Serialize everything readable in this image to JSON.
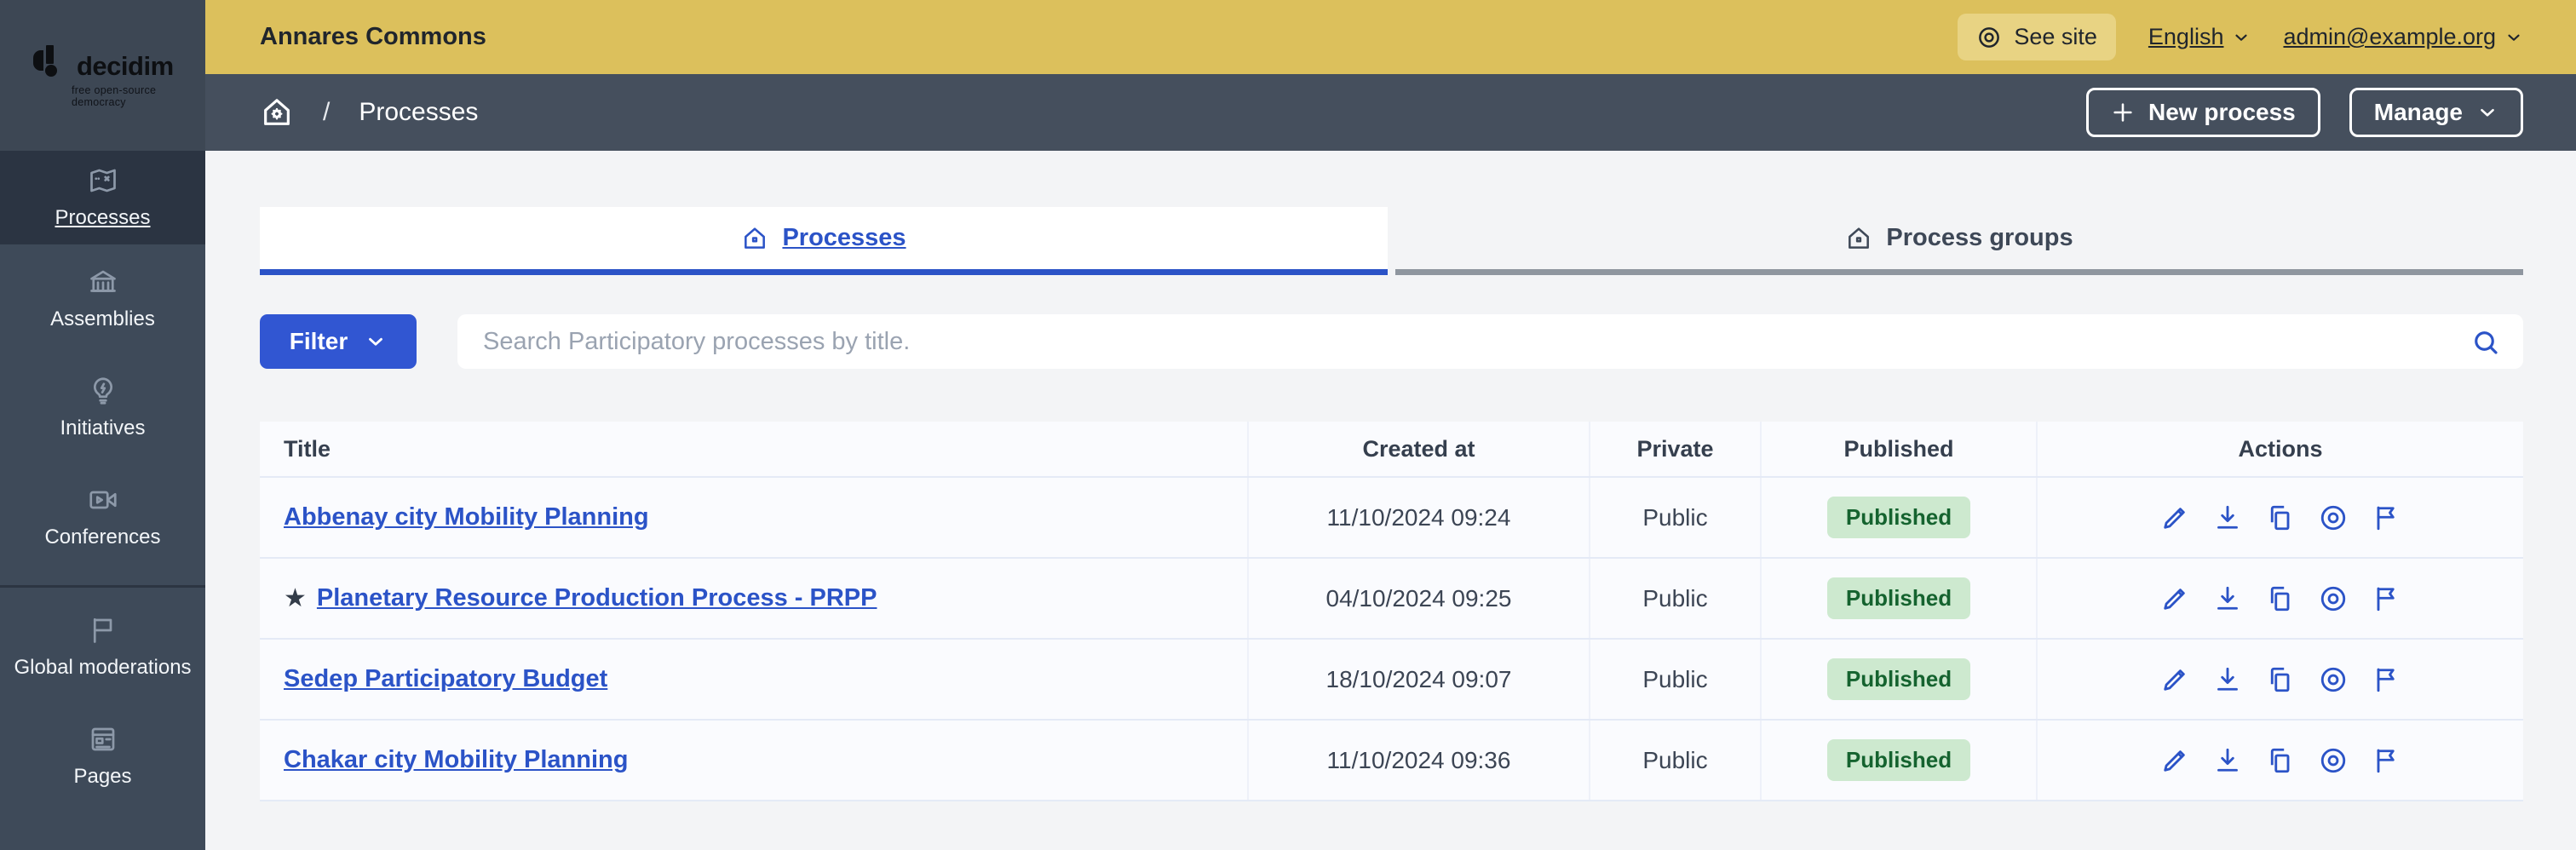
{
  "sidebar": {
    "logo_title": "decidim",
    "logo_tagline": "free open-source democracy",
    "items": [
      {
        "label": "Processes",
        "icon": "map-icon",
        "active": true
      },
      {
        "label": "Assemblies",
        "icon": "government-building-icon",
        "active": false
      },
      {
        "label": "Initiatives",
        "icon": "lightbulb-icon",
        "active": false
      },
      {
        "label": "Conferences",
        "icon": "video-camera-icon",
        "active": false
      },
      {
        "label": "Global moderations",
        "icon": "flag-icon",
        "active": false
      },
      {
        "label": "Pages",
        "icon": "page-icon",
        "active": false
      }
    ]
  },
  "topbar": {
    "org_name": "Annares Commons",
    "see_site_label": "See site",
    "language_label": "English",
    "user_email": "admin@example.org"
  },
  "breadcrumb": {
    "separator": "/",
    "current": "Processes",
    "new_process_label": "New process",
    "manage_label": "Manage"
  },
  "tabs": [
    {
      "label": "Processes",
      "icon": "home-icon",
      "active": true
    },
    {
      "label": "Process groups",
      "icon": "home-icon",
      "active": false
    }
  ],
  "filters": {
    "filter_label": "Filter",
    "search_placeholder": "Search Participatory processes by title."
  },
  "table": {
    "headers": [
      "Title",
      "Created at",
      "Private",
      "Published",
      "Actions"
    ],
    "action_icons": [
      "pencil-icon",
      "download-icon",
      "copy-icon",
      "preview-icon",
      "flag-icon"
    ],
    "rows": [
      {
        "title": "Abbenay city Mobility Planning",
        "starred": false,
        "created_at": "11/10/2024 09:24",
        "private": "Public",
        "published": "Published"
      },
      {
        "title": "Planetary Resource Production Process - PRPP",
        "starred": true,
        "created_at": "04/10/2024 09:25",
        "private": "Public",
        "published": "Published"
      },
      {
        "title": "Sedep Participatory Budget",
        "starred": false,
        "created_at": "18/10/2024 09:07",
        "private": "Public",
        "published": "Published"
      },
      {
        "title": "Chakar city Mobility Planning",
        "starred": false,
        "created_at": "11/10/2024 09:36",
        "private": "Public",
        "published": "Published"
      }
    ]
  },
  "colors": {
    "accent_blue": "#2b53c7",
    "topbar_yellow": "#dcc05c",
    "sidebar_slate": "#3e4a59",
    "badge_green_bg": "#cde9cf",
    "badge_green_text": "#15632f"
  }
}
